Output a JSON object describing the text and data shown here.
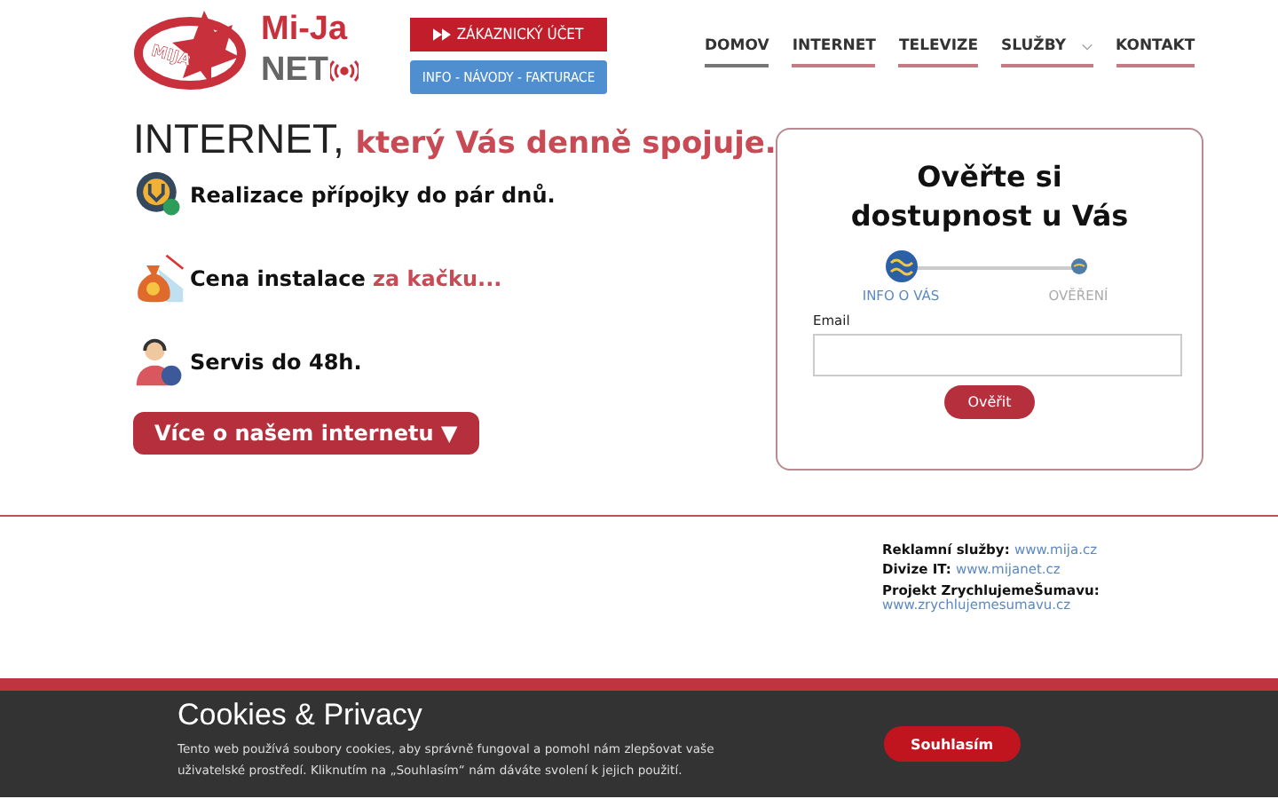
{
  "logo": {
    "line_1": "Mi-Ja",
    "line_2": "NET",
    "badge": "MIJA"
  },
  "header_buttons": [
    {
      "label": "ZÁKAZNICKÝ ÚČET",
      "kind": "account"
    },
    {
      "label": "INFO - NÁVODY - FAKTURACE",
      "kind": "info"
    }
  ],
  "nav": [
    {
      "label": "DOMOV",
      "selected": true,
      "dropdown": false
    },
    {
      "label": "INTERNET",
      "selected": false,
      "dropdown": false
    },
    {
      "label": "TELEVIZE",
      "selected": false,
      "dropdown": false
    },
    {
      "label": "SLUŽBY",
      "selected": false,
      "dropdown": true
    },
    {
      "label": "KONTAKT",
      "selected": false,
      "dropdown": false
    }
  ],
  "hero": {
    "title": "INTERNET,",
    "title_accent": "který Vás denně spojuje.",
    "features": [
      {
        "kind": "gear",
        "text": "Realizace přípojky do pár dnů."
      },
      {
        "kind": "money",
        "text": "Cena instalace **za kačku...**"
      },
      {
        "kind": "support",
        "text": "Servis do 48h."
      }
    ],
    "more_button": "Více o našem internetu ▼"
  },
  "check_card": {
    "title": "Ověřte si dostupnost u Vás",
    "steps": [
      {
        "label": "INFO O VÁS",
        "selected": true
      },
      {
        "label": "OVĚŘENÍ",
        "selected": false
      }
    ],
    "email_label": "Email",
    "submit": "Ověřit"
  },
  "footer_links": [
    {
      "label": "Reklamní služby:",
      "link": "www.mija.cz"
    },
    {
      "label": "Divize IT:",
      "link": "www.mijanet.cz"
    },
    {
      "label": "Projekt ZrychlujemeŠumavu:",
      "link": "www.zrychlujemesumavu.cz"
    }
  ],
  "cookie_bar": {
    "title": "Cookies & Privacy",
    "text": "Tento web používá soubory cookies, aby správně fungoval a pomohl nám zlepšovat vaše uživatelské prostředí. Kliknutím na „Souhlasím“ nám dáváte svolení k jejich použití.",
    "accept": "Souhlasím"
  }
}
